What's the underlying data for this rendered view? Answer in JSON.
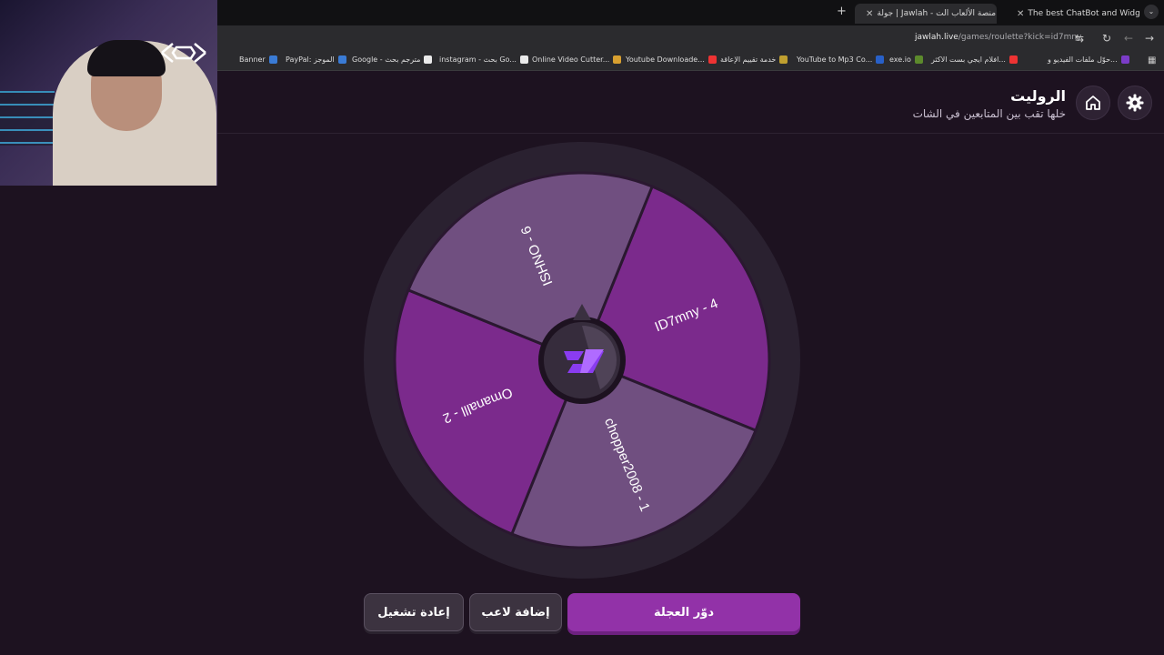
{
  "browser": {
    "tabs": [
      {
        "title": "The best ChatBot and Widg",
        "active": false
      },
      {
        "title": "جولة | Jawlah - منصة الألعاب الت",
        "active": true
      }
    ],
    "url_host": "jawlah.live",
    "url_path": "/games/roulette?kick=id7mny",
    "bookmarks": [
      "حوّل ملفات الفيديو و...",
      "افلام ايجي بست الاكثر...",
      "exe.io",
      "YouTube to Mp3 Co...",
      "خدمة تقييم الإعاقة",
      "Youtube Downloade...",
      "Online Video Cutter...",
      "instagram - بحث Go...",
      "Google - مترجم بحث",
      "PayPal: الموجز",
      "Banner"
    ]
  },
  "page": {
    "title": "الروليت",
    "subtitle": "خلها تقب بين المتابعين في الشات"
  },
  "wheel": {
    "segments": [
      {
        "label": "ID7mny - 4",
        "color": "#7b2a8c"
      },
      {
        "label": "chopper2008 - 1",
        "color": "#704f80"
      },
      {
        "label": "Omanalll - 2",
        "color": "#7b2a8c"
      },
      {
        "label": "ISHNO - 6",
        "color": "#704f80"
      }
    ],
    "rim_color": "#2a2130",
    "center_logo": "7 logo"
  },
  "buttons": {
    "spin": "دوّر العجلة",
    "add_player": "إضافة لاعب",
    "restart": "إعادة تشغيل"
  },
  "colors": {
    "background": "#1d1220",
    "accent": "#9232a8"
  }
}
